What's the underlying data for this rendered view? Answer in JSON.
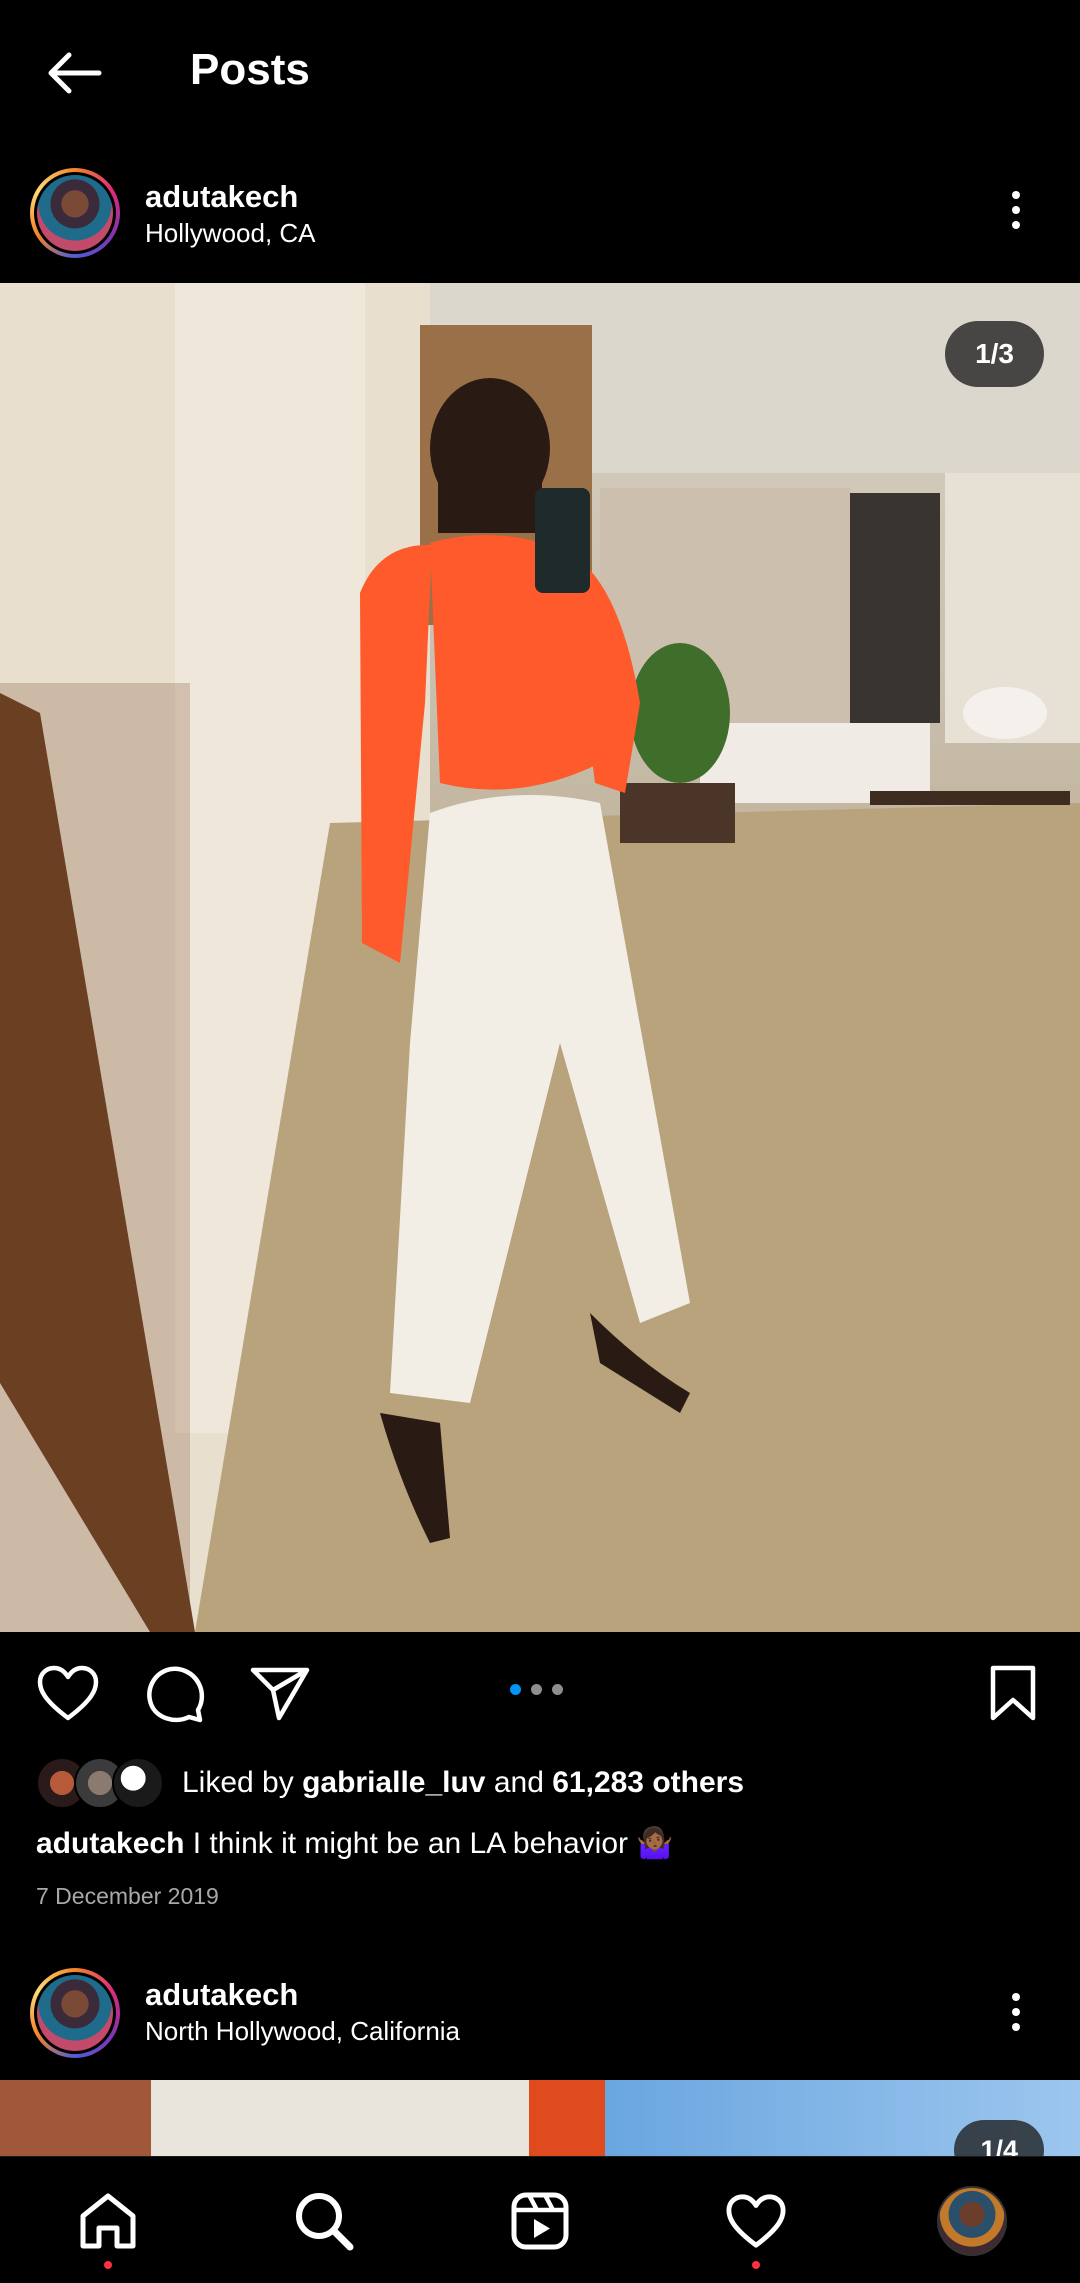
{
  "header": {
    "title": "Posts"
  },
  "post1": {
    "username": "adutakech",
    "location": "Hollywood, CA",
    "media_counter": "1/3",
    "carousel": {
      "count": 3,
      "active_index": 0
    },
    "likes": {
      "prefix": "Liked by ",
      "liked_by_user": "gabrialle_luv",
      "middle": " and ",
      "others": "61,283 others"
    },
    "caption": {
      "username": "adutakech",
      "text": " I think it might be an LA behavior 🤷🏾‍♀️"
    },
    "date": "7 December 2019"
  },
  "post2": {
    "username": "adutakech",
    "location": "North Hollywood, California",
    "media_counter": "1/4"
  },
  "icons": {
    "back": "arrow-left-icon",
    "more": "more-vertical-icon",
    "like": "heart-icon",
    "comment": "comment-icon",
    "share": "paper-plane-icon",
    "save": "bookmark-icon",
    "nav": [
      "home-icon",
      "search-icon",
      "reels-icon",
      "activity-heart-icon",
      "profile-avatar"
    ]
  },
  "colors": {
    "background": "#000000",
    "accent_blue": "#0095f6",
    "notification_red": "#ff3040"
  }
}
